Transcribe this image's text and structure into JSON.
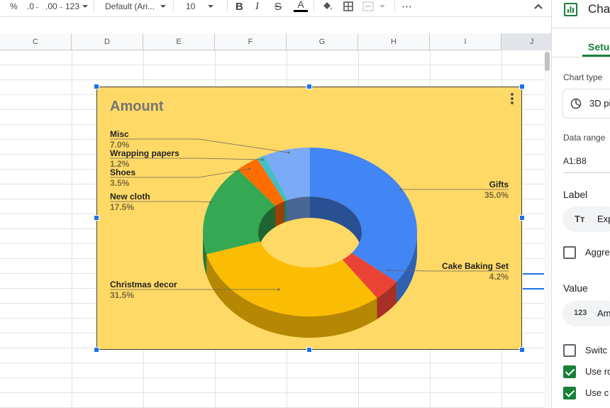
{
  "toolbar": {
    "percent": "%",
    "decimal_decrease": ".0",
    "decimal_increase": ".00",
    "more_formats": "123",
    "font": "Default (Ari...",
    "font_size": "10",
    "bold": "B",
    "italic": "I",
    "strikethrough": "S",
    "text_color_letter": "A",
    "more": "⋯"
  },
  "columns": [
    "C",
    "D",
    "E",
    "F",
    "G",
    "H",
    "I",
    "J"
  ],
  "chart": {
    "menu_icon": "kebab-menu-icon",
    "colors": {
      "background": "#ffd966",
      "Gifts": "#4285f4",
      "Cake Baking Set": "#ea4335",
      "Christmas decor": "#fbbc04",
      "New cloth": "#34a853",
      "Shoes": "#ff6d01",
      "Wrapping papers": "#46bdc6",
      "Misc": "#7baaf7"
    }
  },
  "chart_data": {
    "type": "pie",
    "variant": "3D donut",
    "title": "Amount",
    "categories": [
      "Gifts",
      "Cake Baking Set",
      "Christmas decor",
      "New cloth",
      "Shoes",
      "Wrapping papers",
      "Misc"
    ],
    "values": [
      35.0,
      4.2,
      31.5,
      17.5,
      3.5,
      1.2,
      7.0
    ],
    "value_labels": [
      "35.0%",
      "4.2%",
      "31.5%",
      "17.5%",
      "3.5%",
      "1.2%",
      "7.0%"
    ],
    "legend": "labeled"
  },
  "panel": {
    "title": "Cha",
    "tab_setup": "Setu",
    "chart_type_label": "Chart type",
    "chart_type_value": "3D pi",
    "data_range_label": "Data range",
    "data_range_value": "A1:B8",
    "label_section": "Label",
    "label_value": "Exp",
    "aggregate_label": "Aggre",
    "value_section": "Value",
    "value_value": "Am",
    "switch_label": "Switc",
    "use_row_label": "Use ro",
    "use_col_label": "Use c",
    "checkboxes": {
      "aggregate": false,
      "switch": false,
      "use_row": true,
      "use_col": true
    }
  }
}
